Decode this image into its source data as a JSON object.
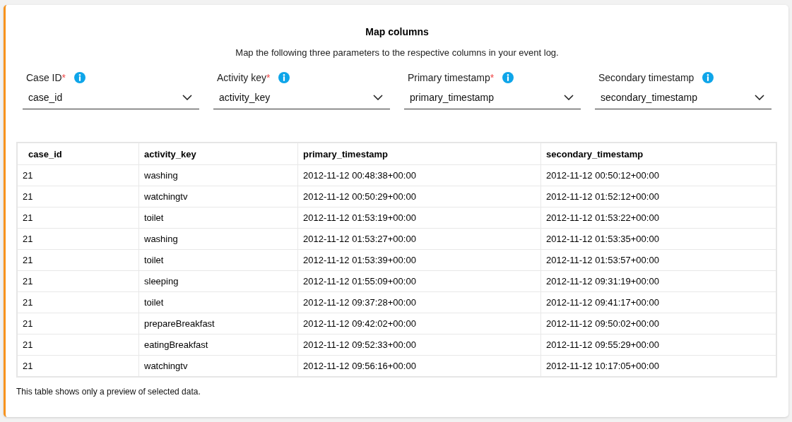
{
  "title": "Map columns",
  "subtitle": "Map the following three parameters to the respective columns in your event log.",
  "mappings": [
    {
      "label": "Case ID",
      "required_mark": "*",
      "value": "case_id"
    },
    {
      "label": "Activity key",
      "required_mark": "*",
      "value": "activity_key"
    },
    {
      "label": "Primary timestamp",
      "required_mark": "*",
      "value": "primary_timestamp"
    },
    {
      "label": "Secondary timestamp",
      "value": "secondary_timestamp"
    }
  ],
  "table": {
    "columns": [
      "case_id",
      "activity_key",
      "primary_timestamp",
      "secondary_timestamp"
    ],
    "rows": [
      [
        "21",
        "washing",
        "2012-11-12 00:48:38+00:00",
        "2012-11-12 00:50:12+00:00"
      ],
      [
        "21",
        "watchingtv",
        "2012-11-12 00:50:29+00:00",
        "2012-11-12 01:52:12+00:00"
      ],
      [
        "21",
        "toilet",
        "2012-11-12 01:53:19+00:00",
        "2012-11-12 01:53:22+00:00"
      ],
      [
        "21",
        "washing",
        "2012-11-12 01:53:27+00:00",
        "2012-11-12 01:53:35+00:00"
      ],
      [
        "21",
        "toilet",
        "2012-11-12 01:53:39+00:00",
        "2012-11-12 01:53:57+00:00"
      ],
      [
        "21",
        "sleeping",
        "2012-11-12 01:55:09+00:00",
        "2012-11-12 09:31:19+00:00"
      ],
      [
        "21",
        "toilet",
        "2012-11-12 09:37:28+00:00",
        "2012-11-12 09:41:17+00:00"
      ],
      [
        "21",
        "prepareBreakfast",
        "2012-11-12 09:42:02+00:00",
        "2012-11-12 09:50:02+00:00"
      ],
      [
        "21",
        "eatingBreakfast",
        "2012-11-12 09:52:33+00:00",
        "2012-11-12 09:55:29+00:00"
      ],
      [
        "21",
        "watchingtv",
        "2012-11-12 09:56:16+00:00",
        "2012-11-12 10:17:05+00:00"
      ]
    ]
  },
  "footnote": "This table shows only a preview of selected data."
}
